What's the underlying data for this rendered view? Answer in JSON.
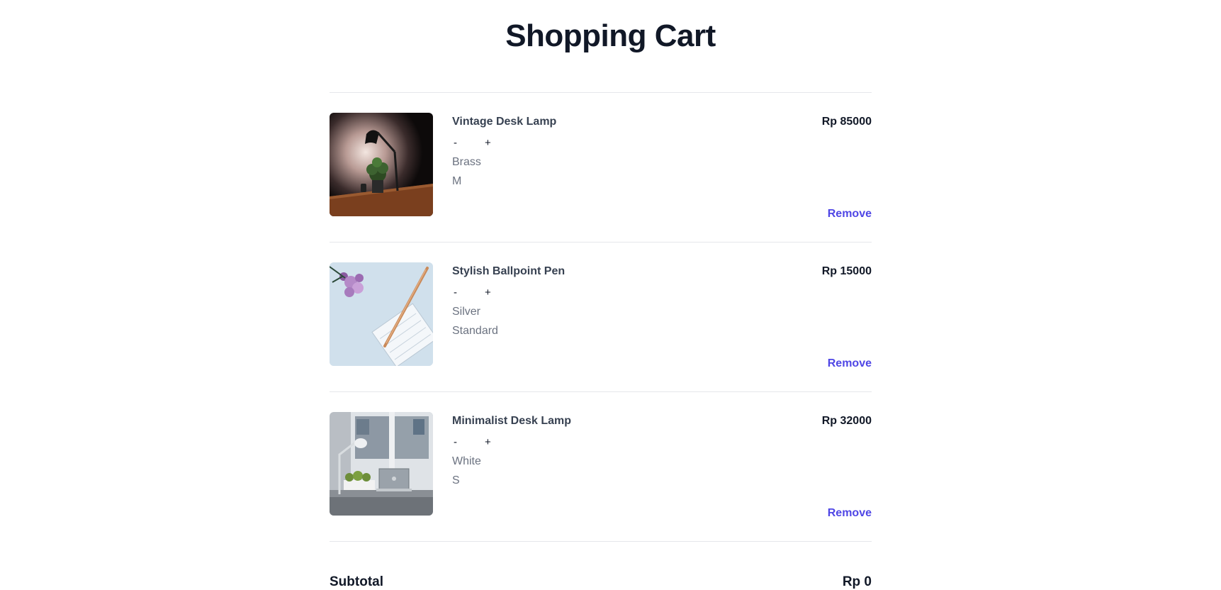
{
  "page": {
    "title": "Shopping Cart"
  },
  "cart": {
    "items": [
      {
        "name": "Vintage Desk Lamp",
        "price": "Rp 85000",
        "decrement": "-",
        "increment": "+",
        "color": "Brass",
        "size": "M",
        "remove_label": "Remove"
      },
      {
        "name": "Stylish Ballpoint Pen",
        "price": "Rp 15000",
        "decrement": "-",
        "increment": "+",
        "color": "Silver",
        "size": "Standard",
        "remove_label": "Remove"
      },
      {
        "name": "Minimalist Desk Lamp",
        "price": "Rp 32000",
        "decrement": "-",
        "increment": "+",
        "color": "White",
        "size": "S",
        "remove_label": "Remove"
      }
    ],
    "subtotal_label": "Subtotal",
    "subtotal_value": "Rp 0"
  },
  "colors": {
    "accent": "#4f46e5",
    "heading": "#111827",
    "muted": "#6b7280",
    "divider": "#e5e7eb"
  }
}
